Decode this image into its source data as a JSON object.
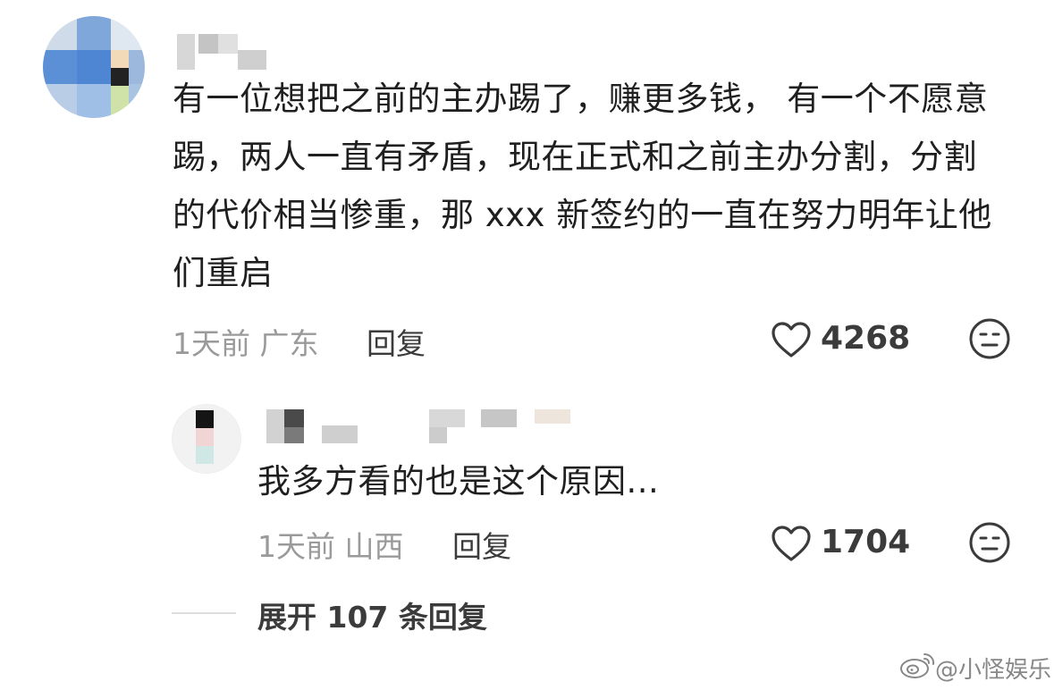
{
  "comment": {
    "text": "有一位想把之前的主办踢了，赚更多钱， 有一个不愿意踢，两人一直有矛盾，现在正式和之前主办分割，分割的代价相当惨重，那 xxx 新签约的一直在努力明年让他们重启",
    "time_location": "1天前 广东",
    "reply_label": "回复",
    "likes": "4268",
    "like_icon": "heart-outline-icon",
    "dislike_icon": "meh-face-icon"
  },
  "reply": {
    "text": "我多方看的也是这个原因...",
    "time_location": "1天前 山西",
    "reply_label": "回复",
    "likes": "1704"
  },
  "expand": {
    "label": "展开 107 条回复"
  },
  "watermark": {
    "text": "@小怪娱乐",
    "icon": "weibo-logo-icon"
  },
  "colors": {
    "text": "#1f1f1f",
    "meta": "#9a9a9a",
    "action": "#3b3b3b"
  }
}
